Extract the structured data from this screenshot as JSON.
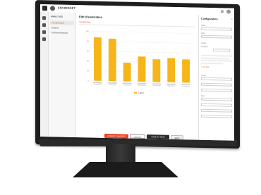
{
  "app": {
    "brand": "ENVIRONET"
  },
  "nav": {
    "header": "ANALYTICS",
    "items": [
      {
        "label": "Visualizations",
        "active": true
      },
      {
        "label": "Reports",
        "active": false
      },
      {
        "label": "Archived Reports",
        "active": false
      }
    ]
  },
  "main": {
    "title": "Edit Visualization",
    "tab": "Visualization"
  },
  "chart_data": {
    "type": "bar",
    "title": "",
    "categories": [
      "",
      "",
      "",
      "",
      "",
      "",
      ""
    ],
    "values": [
      88,
      86,
      38,
      51,
      46,
      49,
      47
    ],
    "ylim": [
      0,
      100
    ],
    "yticks": [
      0,
      20,
      40,
      60,
      80,
      100
    ],
    "color": "#f6b519",
    "legend": [
      "Label"
    ],
    "grid": true
  },
  "actions": {
    "primary": "UPDATE CHANGES",
    "outline": "CANCEL",
    "dark": "SAVE AS NEW",
    "light": "SAVE"
  },
  "config": {
    "title": "Configuration",
    "fields": [
      {
        "label": "Name",
        "value": ""
      },
      {
        "label": "Date",
        "value": ""
      },
      {
        "label": "X-Axis",
        "value": ""
      },
      {
        "label": "Category",
        "value": ""
      },
      {
        "label": "Y-Axis",
        "value": ""
      },
      {
        "label": "Type",
        "value": ""
      }
    ],
    "link": "+ Add field"
  },
  "colors": {
    "accent": "#e8572a",
    "bar": "#f6b519"
  }
}
